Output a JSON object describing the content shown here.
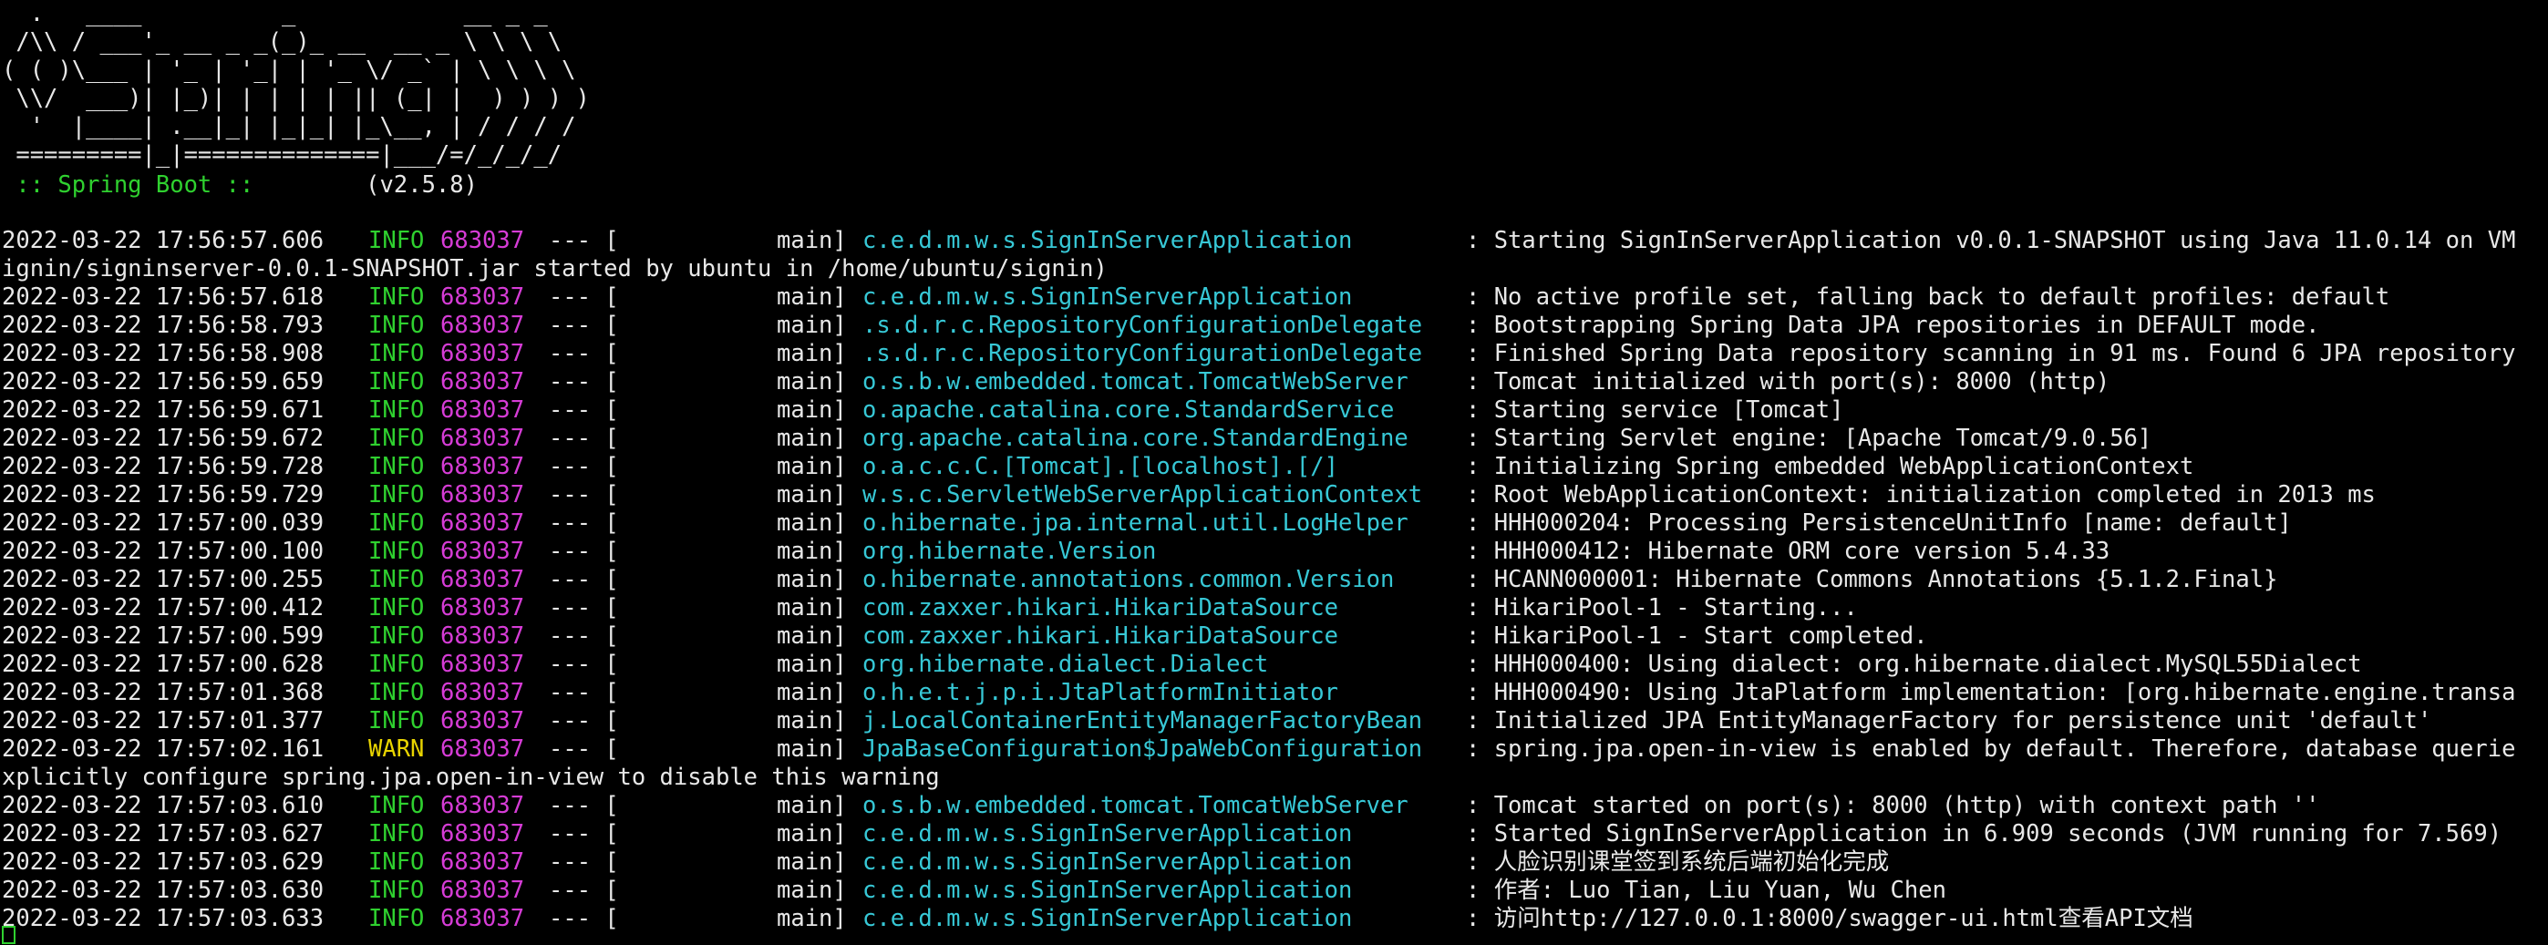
{
  "banner": {
    "ascii_lines": [
      "  .   ____          _            __ _ _",
      " /\\\\ / ___'_ __ _ _(_)_ __  __ _ \\ \\ \\ \\",
      "( ( )\\___ | '_ | '_| | '_ \\/ _` | \\ \\ \\ \\",
      " \\\\/  ___)| |_)| | | | | || (_| |  ) ) ) )",
      "  '  |____| .__|_| |_|_| |_\\__, | / / / /",
      " =========|_|==============|___/=/_/_/_/"
    ],
    "spring_label": " :: Spring Boot :: ",
    "spring_version": "       (v2.5.8)"
  },
  "log": [
    {
      "ts": "2022-03-22 17:56:57.606",
      "level": "INFO",
      "pid": "683037",
      "sep": "--- [",
      "thread": "main]",
      "cls": "c.e.d.m.w.s.SignInServerApplication",
      "msg": ": Starting SignInServerApplication v0.0.1-SNAPSHOT using Java 11.0.14 on VM"
    },
    {
      "cont": "ignin/signinserver-0.0.1-SNAPSHOT.jar started by ubuntu in /home/ubuntu/signin)"
    },
    {
      "ts": "2022-03-22 17:56:57.618",
      "level": "INFO",
      "pid": "683037",
      "sep": "--- [",
      "thread": "main]",
      "cls": "c.e.d.m.w.s.SignInServerApplication",
      "msg": ": No active profile set, falling back to default profiles: default"
    },
    {
      "ts": "2022-03-22 17:56:58.793",
      "level": "INFO",
      "pid": "683037",
      "sep": "--- [",
      "thread": "main]",
      "cls": ".s.d.r.c.RepositoryConfigurationDelegate",
      "msg": ": Bootstrapping Spring Data JPA repositories in DEFAULT mode."
    },
    {
      "ts": "2022-03-22 17:56:58.908",
      "level": "INFO",
      "pid": "683037",
      "sep": "--- [",
      "thread": "main]",
      "cls": ".s.d.r.c.RepositoryConfigurationDelegate",
      "msg": ": Finished Spring Data repository scanning in 91 ms. Found 6 JPA repository"
    },
    {
      "ts": "2022-03-22 17:56:59.659",
      "level": "INFO",
      "pid": "683037",
      "sep": "--- [",
      "thread": "main]",
      "cls": "o.s.b.w.embedded.tomcat.TomcatWebServer",
      "msg": ": Tomcat initialized with port(s): 8000 (http)"
    },
    {
      "ts": "2022-03-22 17:56:59.671",
      "level": "INFO",
      "pid": "683037",
      "sep": "--- [",
      "thread": "main]",
      "cls": "o.apache.catalina.core.StandardService",
      "msg": ": Starting service [Tomcat]"
    },
    {
      "ts": "2022-03-22 17:56:59.672",
      "level": "INFO",
      "pid": "683037",
      "sep": "--- [",
      "thread": "main]",
      "cls": "org.apache.catalina.core.StandardEngine",
      "msg": ": Starting Servlet engine: [Apache Tomcat/9.0.56]"
    },
    {
      "ts": "2022-03-22 17:56:59.728",
      "level": "INFO",
      "pid": "683037",
      "sep": "--- [",
      "thread": "main]",
      "cls": "o.a.c.c.C.[Tomcat].[localhost].[/]",
      "msg": ": Initializing Spring embedded WebApplicationContext"
    },
    {
      "ts": "2022-03-22 17:56:59.729",
      "level": "INFO",
      "pid": "683037",
      "sep": "--- [",
      "thread": "main]",
      "cls": "w.s.c.ServletWebServerApplicationContext",
      "msg": ": Root WebApplicationContext: initialization completed in 2013 ms"
    },
    {
      "ts": "2022-03-22 17:57:00.039",
      "level": "INFO",
      "pid": "683037",
      "sep": "--- [",
      "thread": "main]",
      "cls": "o.hibernate.jpa.internal.util.LogHelper",
      "msg": ": HHH000204: Processing PersistenceUnitInfo [name: default]"
    },
    {
      "ts": "2022-03-22 17:57:00.100",
      "level": "INFO",
      "pid": "683037",
      "sep": "--- [",
      "thread": "main]",
      "cls": "org.hibernate.Version",
      "msg": ": HHH000412: Hibernate ORM core version 5.4.33"
    },
    {
      "ts": "2022-03-22 17:57:00.255",
      "level": "INFO",
      "pid": "683037",
      "sep": "--- [",
      "thread": "main]",
      "cls": "o.hibernate.annotations.common.Version",
      "msg": ": HCANN000001: Hibernate Commons Annotations {5.1.2.Final}"
    },
    {
      "ts": "2022-03-22 17:57:00.412",
      "level": "INFO",
      "pid": "683037",
      "sep": "--- [",
      "thread": "main]",
      "cls": "com.zaxxer.hikari.HikariDataSource",
      "msg": ": HikariPool-1 - Starting..."
    },
    {
      "ts": "2022-03-22 17:57:00.599",
      "level": "INFO",
      "pid": "683037",
      "sep": "--- [",
      "thread": "main]",
      "cls": "com.zaxxer.hikari.HikariDataSource",
      "msg": ": HikariPool-1 - Start completed."
    },
    {
      "ts": "2022-03-22 17:57:00.628",
      "level": "INFO",
      "pid": "683037",
      "sep": "--- [",
      "thread": "main]",
      "cls": "org.hibernate.dialect.Dialect",
      "msg": ": HHH000400: Using dialect: org.hibernate.dialect.MySQL55Dialect"
    },
    {
      "ts": "2022-03-22 17:57:01.368",
      "level": "INFO",
      "pid": "683037",
      "sep": "--- [",
      "thread": "main]",
      "cls": "o.h.e.t.j.p.i.JtaPlatformInitiator",
      "msg": ": HHH000490: Using JtaPlatform implementation: [org.hibernate.engine.transa"
    },
    {
      "ts": "2022-03-22 17:57:01.377",
      "level": "INFO",
      "pid": "683037",
      "sep": "--- [",
      "thread": "main]",
      "cls": "j.LocalContainerEntityManagerFactoryBean",
      "msg": ": Initialized JPA EntityManagerFactory for persistence unit 'default'"
    },
    {
      "ts": "2022-03-22 17:57:02.161",
      "level": "WARN",
      "pid": "683037",
      "sep": "--- [",
      "thread": "main]",
      "cls": "JpaBaseConfiguration$JpaWebConfiguration",
      "msg": ": spring.jpa.open-in-view is enabled by default. Therefore, database querie"
    },
    {
      "cont": "xplicitly configure spring.jpa.open-in-view to disable this warning"
    },
    {
      "ts": "2022-03-22 17:57:03.610",
      "level": "INFO",
      "pid": "683037",
      "sep": "--- [",
      "thread": "main]",
      "cls": "o.s.b.w.embedded.tomcat.TomcatWebServer",
      "msg": ": Tomcat started on port(s): 8000 (http) with context path ''"
    },
    {
      "ts": "2022-03-22 17:57:03.627",
      "level": "INFO",
      "pid": "683037",
      "sep": "--- [",
      "thread": "main]",
      "cls": "c.e.d.m.w.s.SignInServerApplication",
      "msg": ": Started SignInServerApplication in 6.909 seconds (JVM running for 7.569)"
    },
    {
      "ts": "2022-03-22 17:57:03.629",
      "level": "INFO",
      "pid": "683037",
      "sep": "--- [",
      "thread": "main]",
      "cls": "c.e.d.m.w.s.SignInServerApplication",
      "msg": ": 人脸识别课堂签到系统后端初始化完成"
    },
    {
      "ts": "2022-03-22 17:57:03.630",
      "level": "INFO",
      "pid": "683037",
      "sep": "--- [",
      "thread": "main]",
      "cls": "c.e.d.m.w.s.SignInServerApplication",
      "msg": ": 作者: Luo Tian, Liu Yuan, Wu Chen"
    },
    {
      "ts": "2022-03-22 17:57:03.633",
      "level": "INFO",
      "pid": "683037",
      "sep": "--- [",
      "thread": "main]",
      "cls": "c.e.d.m.w.s.SignInServerApplication",
      "msg": ": 访问http://127.0.0.1:8000/swagger-ui.html查看API文档"
    }
  ],
  "colors": {
    "background": "#000000",
    "text": "#e8e8e8",
    "info": "#2fd12f",
    "warn": "#e8d400",
    "pid": "#d63cd6",
    "logger": "#37c8d6",
    "cursor": "#2fd12f"
  }
}
